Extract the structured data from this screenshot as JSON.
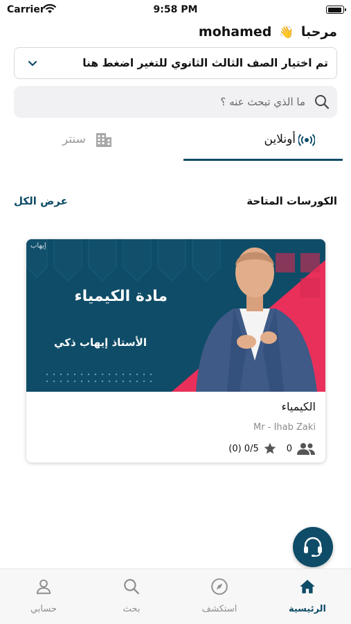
{
  "status_bar": {
    "carrier": "Carrier",
    "time": "9:58 PM"
  },
  "header": {
    "greeting": "مرحبا",
    "user_name": "mohamed",
    "wave": "👋"
  },
  "grade_selector": {
    "label": "تم اختيار الصف الثالث الثانوي للتغير اضغط هنا"
  },
  "search": {
    "placeholder": "ما الذي تبحث عنه ؟"
  },
  "tabs": [
    {
      "label": "أونلاين",
      "active": true
    },
    {
      "label": "سنتر",
      "active": false
    }
  ],
  "courses_section": {
    "title": "الكورسات المتاحة",
    "see_all": "عرض الكل"
  },
  "course": {
    "banner_title": "مادة الكيمياء",
    "banner_teacher": "الأستاذ إيهاب ذكي",
    "banner_logo": "إيهاب",
    "name": "الكيمياء",
    "teacher": "Mr - Ihab Zaki",
    "rating_text": "(0) 0/5",
    "students": "0"
  },
  "bottom_nav": [
    {
      "label": "الرئيسية",
      "icon": "home-icon",
      "active": true
    },
    {
      "label": "استكشف",
      "icon": "compass-icon",
      "active": false
    },
    {
      "label": "بحث",
      "icon": "search-icon",
      "active": false
    },
    {
      "label": "حسابي",
      "icon": "user-icon",
      "active": false
    }
  ],
  "colors": {
    "primary": "#0f4c67",
    "accent_red": "#e8305a",
    "background": "#ffffff"
  }
}
